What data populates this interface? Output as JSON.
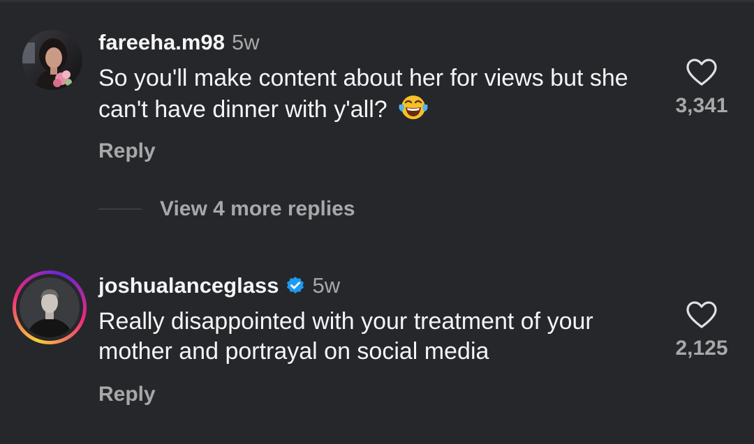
{
  "comments": [
    {
      "username": "fareeha.m98",
      "time": "5w",
      "verified": false,
      "text": "So you'll make content about her for views but she can't have dinner with y'all?",
      "emoji": "face-with-tears-of-joy",
      "reply_label": "Reply",
      "like_count": "3,341"
    },
    {
      "username": "joshualanceglass",
      "time": "5w",
      "verified": true,
      "text": "Really disappointed with your treatment of your mother and portrayal on social media",
      "reply_label": "Reply",
      "like_count": "2,125"
    }
  ],
  "view_more_replies": "View 4 more replies",
  "colors": {
    "background": "#26272b",
    "text_primary": "#f5f5f5",
    "text_secondary": "#a8a8a8",
    "verified_blue": "#1d9bf0",
    "story_ring_start": "#f9ce34",
    "story_ring_mid": "#ee2a7b",
    "story_ring_end": "#6228d7"
  }
}
